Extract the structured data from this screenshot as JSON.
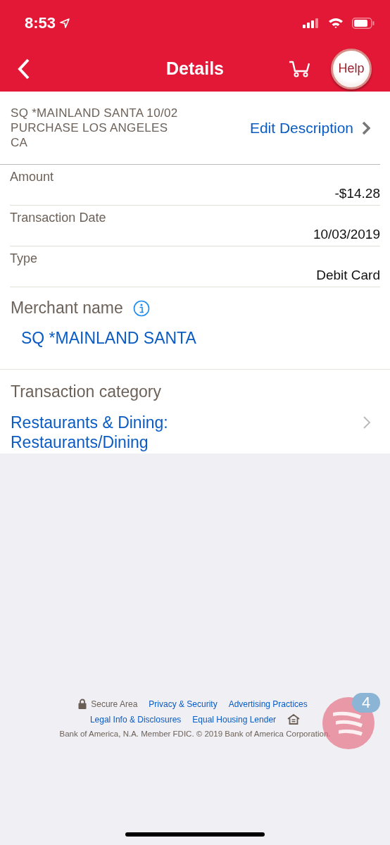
{
  "status_bar": {
    "time": "8:53"
  },
  "nav": {
    "title": "Details",
    "help": "Help"
  },
  "description": {
    "lines": [
      "SQ *MAINLAND SANTA 10/02",
      "PURCHASE LOS ANGELES",
      "CA"
    ],
    "edit_link": "Edit Description"
  },
  "fields": [
    {
      "label": "Amount",
      "value": "-$14.28"
    },
    {
      "label": "Transaction Date",
      "value": "10/03/2019"
    },
    {
      "label": "Type",
      "value": "Debit Card"
    }
  ],
  "merchant": {
    "label": "Merchant name",
    "value": "SQ *MAINLAND SANTA"
  },
  "category": {
    "label": "Transaction category",
    "lines": [
      "Restaurants & Dining:",
      "Restaurants/Dining"
    ]
  },
  "footer": {
    "secure": "Secure Area",
    "links": [
      [
        "Privacy & Security",
        "Advertising Practices"
      ],
      [
        "Legal Info & Disclosures",
        "Equal Housing Lender"
      ]
    ],
    "copyright": "Bank of America, N.A. Member FDIC. © 2019 Bank of America Corporation."
  },
  "chat": {
    "badge": "4"
  }
}
